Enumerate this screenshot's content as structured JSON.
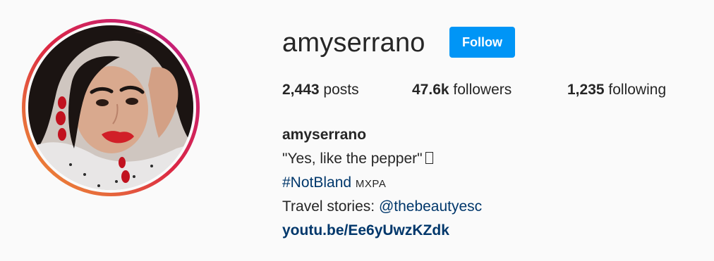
{
  "profile": {
    "username": "amyserrano",
    "follow_label": "Follow",
    "avatar_alt": "amyserrano's profile picture"
  },
  "stats": {
    "posts_count": "2,443",
    "posts_label": "posts",
    "followers_count": "47.6k",
    "followers_label": "followers",
    "following_count": "1,235",
    "following_label": "following"
  },
  "bio": {
    "full_name": "amyserrano",
    "quote": "\"Yes, like the pepper\"",
    "hashtag": "#NotBland",
    "hashtag_suffix": "MXPA",
    "travel_prefix": "Travel stories:",
    "travel_mention": "@thebeautyesc",
    "link": "youtu.be/Ee6yUwzKZdk"
  },
  "colors": {
    "follow_button": "#0095f6",
    "link_text": "#00376b",
    "text": "#262626",
    "background": "#fafafa",
    "story_ring_start": "#f09433",
    "story_ring_end": "#bc1888"
  }
}
